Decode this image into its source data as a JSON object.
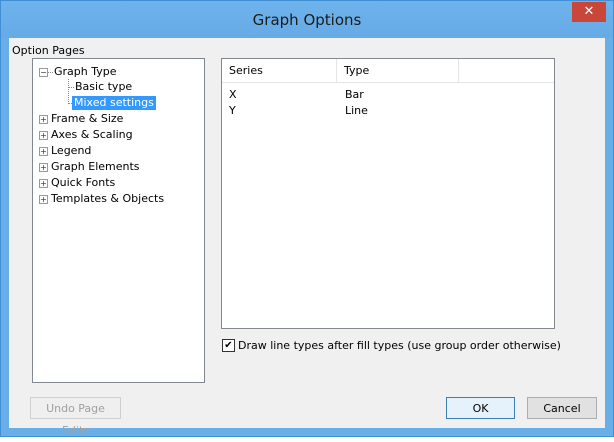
{
  "window": {
    "title": "Graph Options",
    "close_glyph": "✕"
  },
  "option_pages_label": "Option Pages",
  "tree": {
    "graph_type": "Graph Type",
    "basic_type": "Basic type",
    "mixed_settings": "Mixed settings",
    "frame_size": "Frame & Size",
    "axes_scaling": "Axes & Scaling",
    "legend": "Legend",
    "graph_elements": "Graph Elements",
    "quick_fonts": "Quick Fonts",
    "templates_objects": "Templates & Objects"
  },
  "table": {
    "headers": [
      "Series",
      "Type"
    ],
    "rows": [
      {
        "series": "X",
        "type": "Bar"
      },
      {
        "series": "Y",
        "type": "Line"
      }
    ]
  },
  "checkbox": {
    "label": "Draw line types after fill types (use group order otherwise)",
    "checked_glyph": "✔"
  },
  "buttons": {
    "undo": "Undo Page Edits",
    "ok": "OK",
    "cancel": "Cancel"
  }
}
